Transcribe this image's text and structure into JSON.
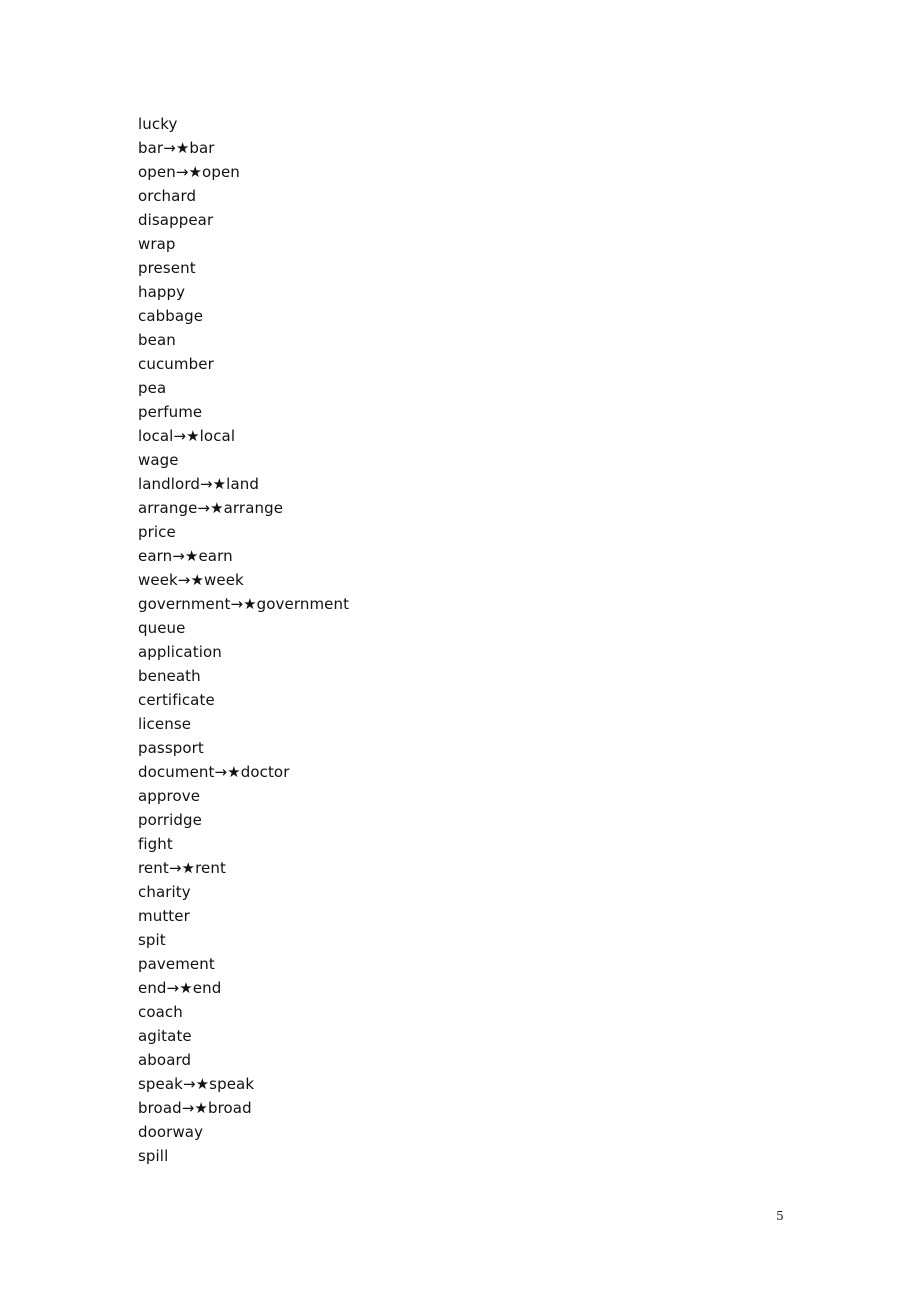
{
  "document": {
    "type": "word-list-page",
    "page_number": "5",
    "background_color": "#ffffff",
    "text_color": "#111111",
    "arrow_glyph": "→",
    "star_glyph": "★",
    "lines": [
      "lucky",
      "bar→★bar",
      "open→★open",
      "orchard",
      "disappear",
      "wrap",
      "present",
      "happy",
      "cabbage",
      "bean",
      "cucumber",
      "pea",
      "perfume",
      "local→★local",
      "wage",
      "landlord→★land",
      "arrange→★arrange",
      "price",
      "earn→★earn",
      "week→★week",
      "government→★government",
      "queue",
      "application",
      "beneath",
      "certificate",
      "license",
      "passport",
      "document→★doctor",
      "approve",
      "porridge",
      "fight",
      "rent→★rent",
      "charity",
      "mutter",
      "spit",
      "pavement",
      "end→★end",
      "coach",
      "agitate",
      "aboard",
      "speak→★speak",
      "broad→★broad",
      "doorway",
      "spill"
    ]
  }
}
